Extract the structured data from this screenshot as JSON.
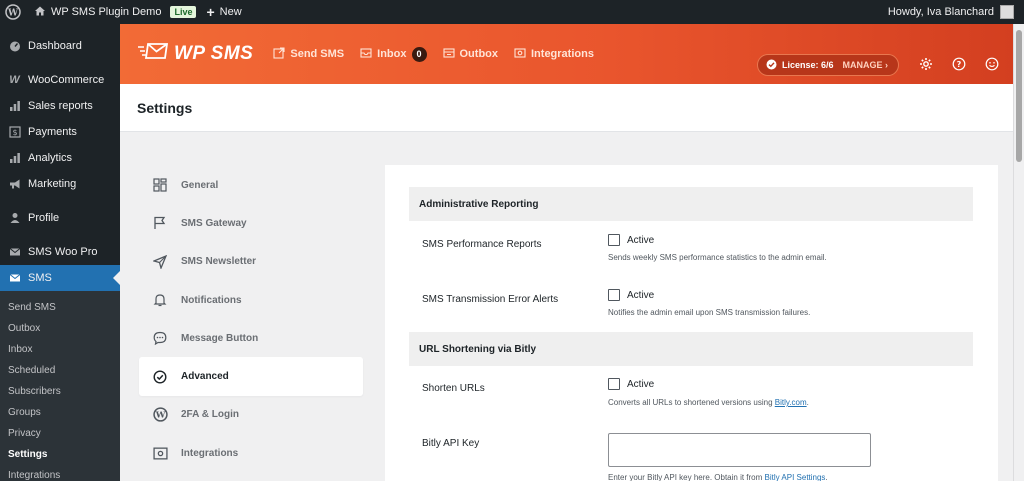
{
  "adminbar": {
    "site_name": "WP SMS Plugin Demo",
    "live_badge": "Live",
    "new_label": "New",
    "howdy": "Howdy, Iva Blanchard"
  },
  "sidebar": {
    "items": [
      {
        "label": "Dashboard",
        "icon": "dashboard-icon"
      },
      {
        "label": "WooCommerce",
        "icon": "woocommerce-icon"
      },
      {
        "label": "Sales reports",
        "icon": "bar-chart-icon"
      },
      {
        "label": "Payments",
        "icon": "dollar-icon"
      },
      {
        "label": "Analytics",
        "icon": "bar-chart-icon"
      },
      {
        "label": "Marketing",
        "icon": "megaphone-icon"
      },
      {
        "label": "Profile",
        "icon": "user-icon"
      },
      {
        "label": "SMS Woo Pro",
        "icon": "envelope-icon"
      },
      {
        "label": "SMS",
        "icon": "envelope-icon"
      }
    ],
    "submenu": [
      "Send SMS",
      "Outbox",
      "Inbox",
      "Scheduled",
      "Subscribers",
      "Groups",
      "Privacy",
      "Settings",
      "Integrations"
    ]
  },
  "plugin_header": {
    "brand": "WP SMS",
    "nav": [
      {
        "label": "Send SMS",
        "icon": "send-icon"
      },
      {
        "label": "Inbox",
        "icon": "inbox-icon",
        "count": "0"
      },
      {
        "label": "Outbox",
        "icon": "outbox-icon"
      },
      {
        "label": "Integrations",
        "icon": "integrations-icon"
      }
    ],
    "license_label": "License: 6/6",
    "manage_label": "MANAGE ›"
  },
  "page": {
    "title": "Settings"
  },
  "tabs": [
    {
      "label": "General",
      "icon": "grid-icon"
    },
    {
      "label": "SMS Gateway",
      "icon": "flag-icon"
    },
    {
      "label": "SMS Newsletter",
      "icon": "paper-plane-icon"
    },
    {
      "label": "Notifications",
      "icon": "bell-icon"
    },
    {
      "label": "Message Button",
      "icon": "chat-icon"
    },
    {
      "label": "Advanced",
      "icon": "check-circle-icon"
    },
    {
      "label": "2FA & Login",
      "icon": "wordpress-icon"
    },
    {
      "label": "Integrations",
      "icon": "integrations-icon"
    }
  ],
  "content": {
    "section1": "Administrative Reporting",
    "row1": {
      "label": "SMS Performance Reports",
      "checkbox": "Active",
      "desc": "Sends weekly SMS performance statistics to the admin email."
    },
    "row2": {
      "label": "SMS Transmission Error Alerts",
      "checkbox": "Active",
      "desc": "Notifies the admin email upon SMS transmission failures."
    },
    "section2": "URL Shortening via Bitly",
    "row3": {
      "label": "Shorten URLs",
      "checkbox": "Active",
      "desc_prefix": "Converts all URLs to shortened versions using ",
      "desc_link": "Bitly.com",
      "desc_suffix": "."
    },
    "row4": {
      "label": "Bitly API Key",
      "value": "",
      "desc_prefix": "Enter your Bitly API key here. Obtain it from ",
      "desc_link": "Bitly API Settings",
      "desc_suffix": "."
    }
  },
  "colors": {
    "accent": "#2271b1",
    "header_start": "#f26b36",
    "header_end": "#d33f20",
    "admin_dark": "#1d2327"
  }
}
